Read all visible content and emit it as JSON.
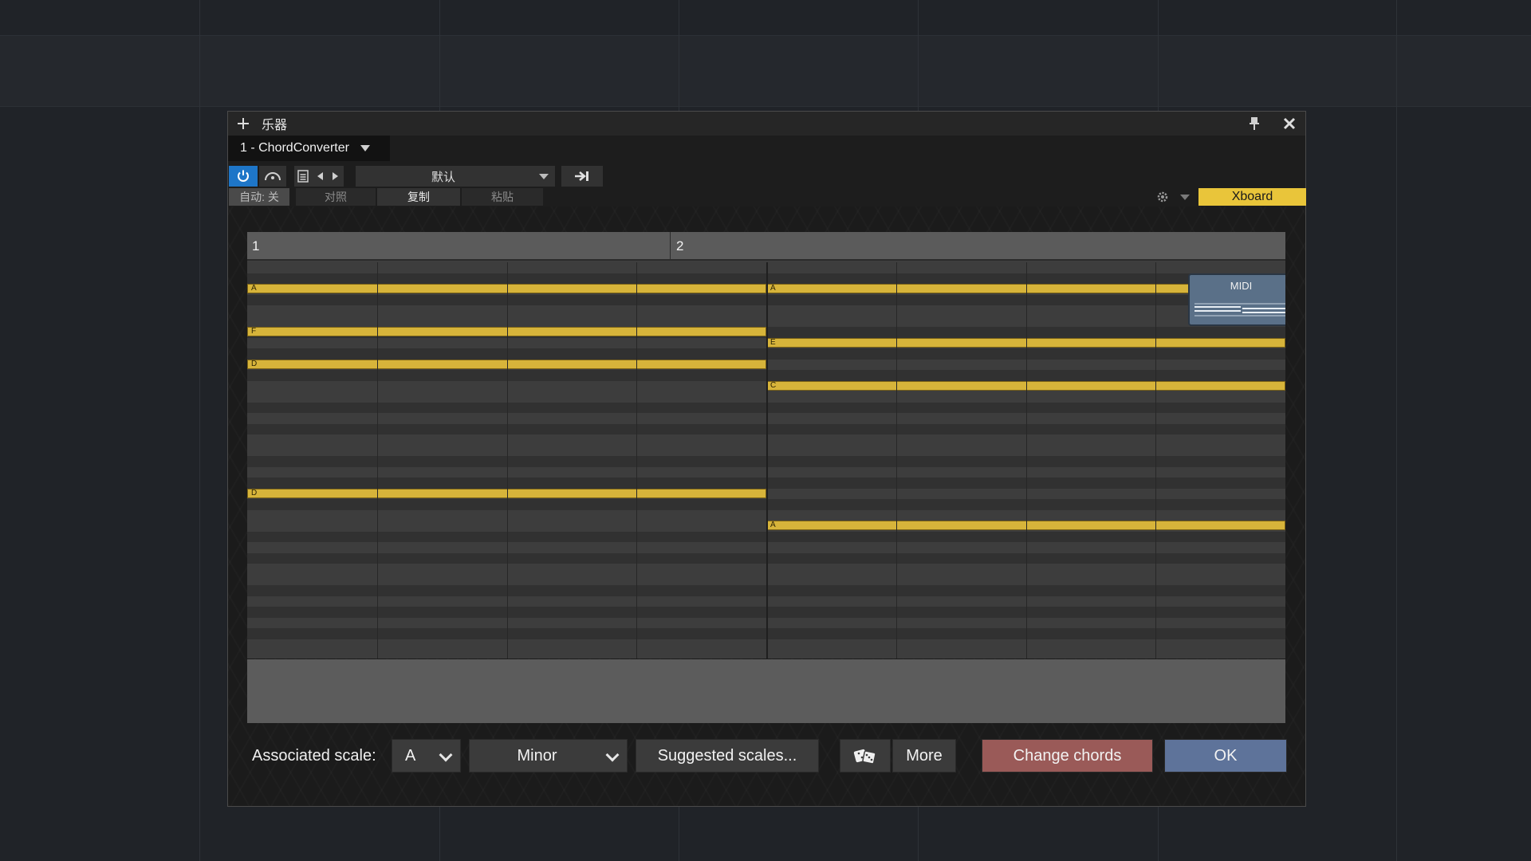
{
  "window": {
    "title": "乐器",
    "preset_name": "1 - ChordConverter"
  },
  "toolbar": {
    "preset_label": "默认",
    "auto_label": "自动: 关",
    "compare_label": "对照",
    "copy_label": "复制",
    "paste_label": "粘贴",
    "xboard_label": "Xboard"
  },
  "piano_roll": {
    "bars": [
      "1",
      "2"
    ],
    "notes": [
      {
        "label": "A",
        "bar": 1,
        "row": 2
      },
      {
        "label": "A",
        "bar": 2,
        "row": 2
      },
      {
        "label": "F",
        "bar": 1,
        "row": 6
      },
      {
        "label": "E",
        "bar": 2,
        "row": 7
      },
      {
        "label": "D",
        "bar": 1,
        "row": 9
      },
      {
        "label": "C",
        "bar": 2,
        "row": 11
      },
      {
        "label": "D",
        "bar": 1,
        "row": 21
      },
      {
        "label": "A",
        "bar": 2,
        "row": 24
      }
    ],
    "midi_badge": "MIDI"
  },
  "controls": {
    "scale_label": "Associated scale:",
    "root_value": "A",
    "mode_value": "Minor",
    "suggest_label": "Suggested scales...",
    "more_label": "More",
    "change_label": "Change chords",
    "ok_label": "OK"
  },
  "colors": {
    "accent_blue": "#1e76c8",
    "note_yellow": "#d7b43a",
    "xboard_yellow": "#e9c53a",
    "change_red": "#9a5a58",
    "ok_blue": "#5e739a"
  }
}
